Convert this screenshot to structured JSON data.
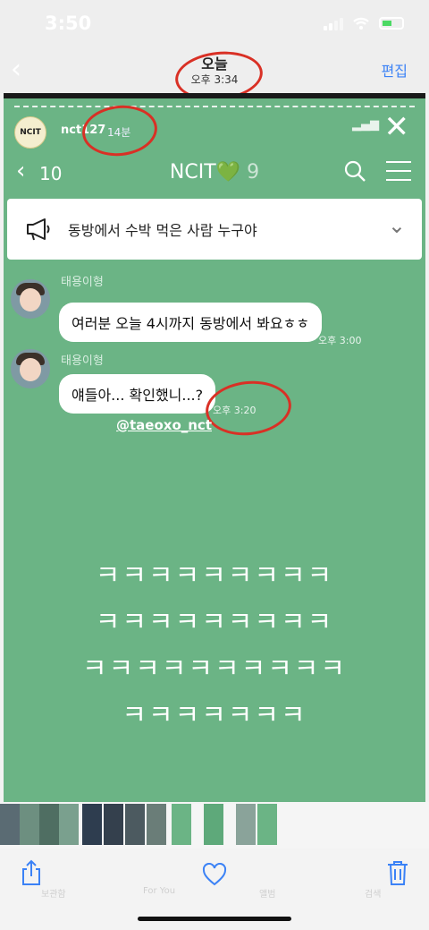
{
  "status_bar": {
    "time": "3:50"
  },
  "header": {
    "title": "오늘",
    "subtitle": "오후 3:34",
    "edit_label": "편집"
  },
  "story": {
    "username": "nct127",
    "age": "14분",
    "chat": {
      "back_count": "10",
      "title": "NCIT",
      "title_emoji": "💚",
      "member_count": "9",
      "notice": "동방에서 수박 먹은 사람 누구야",
      "messages": [
        {
          "sender": "태용이형",
          "text": "여러분 오늘 4시까지 동방에서 봐요ㅎㅎ",
          "time": "오후 3:00"
        },
        {
          "sender": "태용이형",
          "text": "얘들아... 확인했니...?",
          "time": "오후 3:20"
        }
      ],
      "mention": "@taeoxo_nct"
    },
    "laugh_lines": [
      "ㅋㅋㅋㅋㅋㅋㅋㅋㅋ",
      "ㅋㅋㅋㅋㅋㅋㅋㅋㅋ",
      "ㅋㅋㅋㅋㅋㅋㅋㅋㅋㅋ",
      "ㅋㅋㅋㅋㅋㅋㅋ"
    ]
  },
  "toolbar": {
    "ghost_tabs": [
      "보관함",
      "For You",
      "앨범",
      "검색"
    ]
  },
  "colors": {
    "story_bg": "#6bb485",
    "accent": "#3b82f6",
    "annotation_red": "#d93025"
  },
  "icons": [
    "back-chevron-icon",
    "share-icon",
    "heart-icon",
    "trash-icon",
    "search-icon",
    "menu-icon",
    "megaphone-icon",
    "close-icon"
  ]
}
